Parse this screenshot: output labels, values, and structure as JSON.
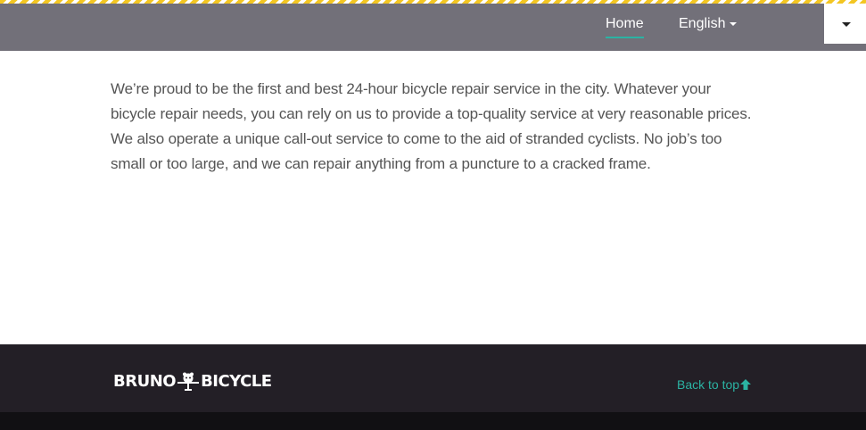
{
  "nav": {
    "home_label": "Home",
    "language_label": "English",
    "menu_toggle_icon": "caret-down-icon"
  },
  "colors": {
    "nav_background": "#727079",
    "hazard_yellow": "#f3c623",
    "accent": "#2bb3a3",
    "footer_background": "#231f26",
    "bottom_bar": "#111013",
    "body_text": "#555555"
  },
  "main": {
    "intro": "We’re proud to be the first and best 24-hour bicycle repair service in the city. Whatever your bicycle repair needs, you can rely on us to provide a top-quality service at very reasonable prices. We also operate a unique call-out service to come to the aid of stranded cyclists. No job’s too small or too large, and we can repair anything from a puncture to a cracked frame."
  },
  "footer": {
    "logo_left": "BRUNO",
    "logo_right": "BICYCLE",
    "logo_icon": "bear-bicycle-icon",
    "back_to_top_label": "Back to top",
    "back_to_top_icon": "arrow-up-icon"
  }
}
